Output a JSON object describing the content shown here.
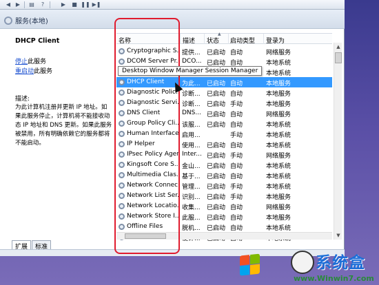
{
  "toolbar": {
    "icons": [
      "back-icon",
      "forward-icon",
      "properties-icon",
      "help-icon",
      "play-icon",
      "stop-icon",
      "pause-icon",
      "restart-icon"
    ]
  },
  "panel": {
    "title": "服务(本地)"
  },
  "left": {
    "service_name": "DHCP Client",
    "stop_link": "停止",
    "stop_suffix": "此服务",
    "restart_link": "重启动",
    "restart_suffix": "此服务",
    "desc_label": "描述:",
    "description": "为此计算机注册并更新 IP 地址。如果此服务停止，计算机将不能接收动态 IP 地址和 DNS 更新。如果此服务被禁用，所有明确依赖它的服务都将不能启动。"
  },
  "grid": {
    "columns": {
      "name": "名称",
      "desc": "描述",
      "status": "状态",
      "startup": "启动类型",
      "logon": "登录为"
    },
    "rows": [
      {
        "name": "Cryptographic S...",
        "desc": "提供...",
        "status": "已启动",
        "startup": "自动",
        "logon": "网络服务"
      },
      {
        "name": "DCOM Server Pr...",
        "desc": "DCO...",
        "status": "已启动",
        "startup": "自动",
        "logon": "本地系统"
      },
      {
        "name": "Desktop Windo...",
        "desc": "",
        "status": "",
        "startup": "",
        "logon": "本地系统"
      },
      {
        "name": "DHCP Client",
        "desc": "为此...",
        "status": "已启动",
        "startup": "自动",
        "logon": "本地服务"
      },
      {
        "name": "Diagnostic Polic...",
        "desc": "诊断...",
        "status": "已启动",
        "startup": "自动",
        "logon": "本地服务"
      },
      {
        "name": "Diagnostic Servi...",
        "desc": "诊断...",
        "status": "已启动",
        "startup": "手动",
        "logon": "本地服务"
      },
      {
        "name": "DNS Client",
        "desc": "DNS...",
        "status": "已启动",
        "startup": "自动",
        "logon": "网络服务"
      },
      {
        "name": "Group Policy Cli...",
        "desc": "该服...",
        "status": "已启动",
        "startup": "自动",
        "logon": "本地系统"
      },
      {
        "name": "Human Interface...",
        "desc": "启用...",
        "status": "",
        "startup": "手动",
        "logon": "本地系统"
      },
      {
        "name": "IP Helper",
        "desc": "使用...",
        "status": "已启动",
        "startup": "自动",
        "logon": "本地系统"
      },
      {
        "name": "IPsec Policy Agent",
        "desc": "Inter...",
        "status": "已启动",
        "startup": "手动",
        "logon": "网络服务"
      },
      {
        "name": "Kingsoft Core S...",
        "desc": "金山...",
        "status": "已启动",
        "startup": "自动",
        "logon": "本地系统"
      },
      {
        "name": "Multimedia Clas...",
        "desc": "基于...",
        "status": "已启动",
        "startup": "自动",
        "logon": "本地系统"
      },
      {
        "name": "Network Connec...",
        "desc": "管理...",
        "status": "已启动",
        "startup": "手动",
        "logon": "本地系统"
      },
      {
        "name": "Network List Ser...",
        "desc": "识别...",
        "status": "已启动",
        "startup": "手动",
        "logon": "本地服务"
      },
      {
        "name": "Network Locatio...",
        "desc": "收集...",
        "status": "已启动",
        "startup": "自动",
        "logon": "网络服务"
      },
      {
        "name": "Network Store I...",
        "desc": "此服...",
        "status": "已启动",
        "startup": "自动",
        "logon": "本地服务"
      },
      {
        "name": "Offline Files",
        "desc": "脱机...",
        "status": "已启动",
        "startup": "自动",
        "logon": "本地系统"
      },
      {
        "name": "Plug and Play",
        "desc": "使计...",
        "status": "已启动",
        "startup": "自动",
        "logon": "本地系统"
      }
    ]
  },
  "tooltip": "Desktop Window Manager Session Manager",
  "tabs": [
    {
      "label": "扩展"
    },
    {
      "label": "标准"
    }
  ],
  "brand": {
    "name": "系统盒",
    "url": "www.Winwin7.com"
  },
  "colors": {
    "selection": "#3399ff",
    "highlight_box": "#e01b2e",
    "link": "#1a4fd0"
  }
}
